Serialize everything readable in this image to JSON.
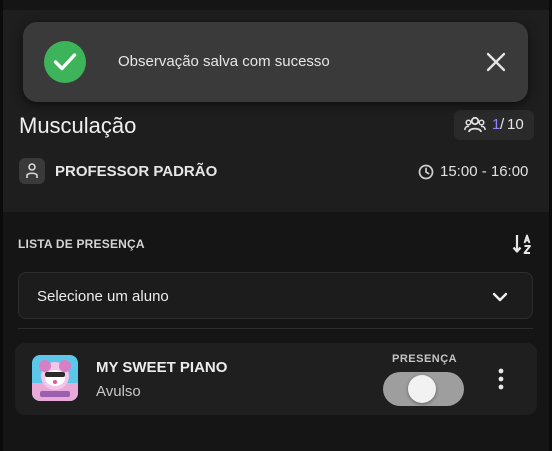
{
  "colors": {
    "accent": "#8f86ff",
    "success": "#3db45a",
    "toast_bg": "#3a3a3a",
    "background": "#151515",
    "card_bg": "#1f1f1f"
  },
  "toast": {
    "message": "Observação salva com sucesso",
    "success_icon": "check-circle-icon",
    "close_icon": "close-icon"
  },
  "class": {
    "title": "Musculação",
    "capacity": {
      "icon": "group-icon",
      "current": "1",
      "separator": "/",
      "total": "10"
    },
    "teacher": {
      "icon": "person-icon",
      "name": "PROFESSOR PADRÃO"
    },
    "schedule": {
      "icon": "clock-icon",
      "time": "15:00 - 16:00"
    }
  },
  "attendance": {
    "section_label": "LISTA DE PRESENÇA",
    "sort_icon": "sort-alpha-icon",
    "select": {
      "value": "Selecione um aluno",
      "chevron_icon": "chevron-down-icon"
    },
    "students": [
      {
        "name": "MY SWEET PIANO",
        "type": "Avulso",
        "presence_label": "PRESENÇA",
        "present": false,
        "more_icon": "more-vertical-icon"
      }
    ]
  }
}
